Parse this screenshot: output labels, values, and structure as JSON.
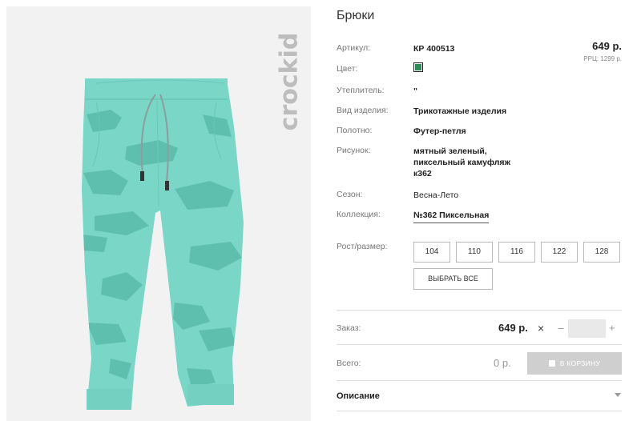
{
  "product": {
    "brand_logo_text": "crockid",
    "title": "Брюки",
    "price": "649 р.",
    "rrc": "РРЦ: 1299 р."
  },
  "attributes": {
    "article_label": "Артикул:",
    "article_value": "КР 400513",
    "color_label": "Цвет:",
    "color_hex": "#2e8b57",
    "insulation_label": "Утеплитель:",
    "insulation_value": "\"",
    "type_label": "Вид изделия:",
    "type_value": "Трикотажные изделия",
    "fabric_label": "Полотно:",
    "fabric_value": "Футер-петля",
    "pattern_label": "Рисунок:",
    "pattern_line1": "мятный зеленый,",
    "pattern_line2": "пиксельный камуфляж",
    "pattern_line3": "к362",
    "season_label": "Сезон:",
    "season_value": "Весна-Лето",
    "collection_label": "Коллекция:",
    "collection_value": "№362 Пиксельная"
  },
  "sizes": {
    "label": "Рост/размер:",
    "options": [
      "104",
      "110",
      "116",
      "122",
      "128"
    ],
    "select_all_label": "ВЫБРАТЬ ВСЕ"
  },
  "order": {
    "label": "Заказ:",
    "price": "649 р.",
    "times_symbol": "×",
    "minus_symbol": "−",
    "plus_symbol": "+",
    "quantity": ""
  },
  "total": {
    "label": "Всего:",
    "value": "0 р.",
    "cart_button_label": "В КОРЗИНУ"
  },
  "description": {
    "label": "Описание"
  },
  "colors": {
    "pants": "#7ad6c6",
    "camo": "#5fbfae",
    "background": "#f2f2f2"
  }
}
